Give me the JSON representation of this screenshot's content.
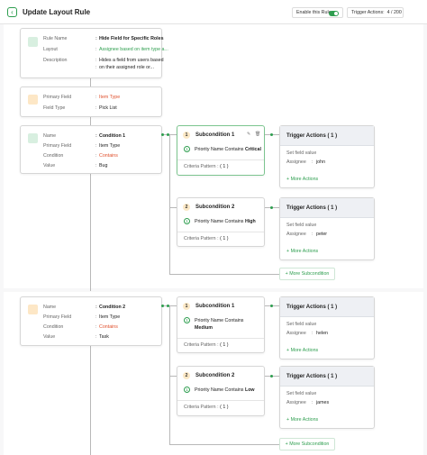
{
  "header": {
    "back_icon": "arrow-left-icon",
    "title": "Update Layout Rule",
    "enable_label": "Enable this Rule:",
    "trigger_label": "Trigger Actions:",
    "trigger_count": "4 / 200"
  },
  "rule": {
    "name_label": "Rule Name",
    "name": "Hide Field for Specific Roles",
    "layout_label": "Layout",
    "layout": "Assignee based on item type a...",
    "desc_label": "Description",
    "desc_line1": "Hides a field from users based",
    "desc_line2": "on their assigned role or..."
  },
  "primary": {
    "field_label": "Primary Field",
    "field": "Item Type",
    "type_label": "Field Type",
    "type": "Pick List"
  },
  "conditions": [
    {
      "name_label": "Name",
      "name": "Condition 1",
      "pf_label": "Primary Field",
      "pf": "Item Type",
      "cond_label": "Condition",
      "cond": "Contains",
      "value_label": "Value",
      "value": "Bug",
      "subconditions": [
        {
          "num": "1",
          "title": "Subcondition 1",
          "pnum": "1",
          "text": "Priority Name Contains",
          "value": "Critical",
          "pattern_label": "Criteria Pattern",
          "pattern": "( 1 )",
          "ta_title": "Trigger Actions  ( 1 )",
          "ta_action": "Set field value",
          "ta_field": "Assignee",
          "ta_value": "john",
          "ta_more": "+ More Actions"
        },
        {
          "num": "2",
          "title": "Subcondition 2",
          "pnum": "1",
          "text": "Priority Name Contains",
          "value": "High",
          "pattern_label": "Criteria Pattern",
          "pattern": "( 1 )",
          "ta_title": "Trigger Actions  ( 1 )",
          "ta_action": "Set field value",
          "ta_field": "Assignee",
          "ta_value": "peter",
          "ta_more": "+ More Actions"
        }
      ],
      "more_sub": "+ More Subcondition"
    },
    {
      "name_label": "Name",
      "name": "Condition 2",
      "pf_label": "Primary Field",
      "pf": "Item Type",
      "cond_label": "Condition",
      "cond": "Contains",
      "value_label": "Value",
      "value": "Task",
      "subconditions": [
        {
          "num": "1",
          "title": "Subcondition 1",
          "pnum": "1",
          "text": "Priority Name Contains",
          "value": "Medium",
          "pattern_label": "Criteria Pattern",
          "pattern": "( 1 )",
          "ta_title": "Trigger Actions  ( 1 )",
          "ta_action": "Set field value",
          "ta_field": "Assignee",
          "ta_value": "helen",
          "ta_more": "+ More Actions"
        },
        {
          "num": "2",
          "title": "Subcondition 2",
          "pnum": "1",
          "text": "Priority Name Contains",
          "value": "Low",
          "pattern_label": "Criteria Pattern",
          "pattern": "( 1 )",
          "ta_title": "Trigger Actions  ( 1 )",
          "ta_action": "Set field value",
          "ta_field": "Assignee",
          "ta_value": "james",
          "ta_more": "+ More Actions"
        }
      ],
      "more_sub": "+ More Subcondition"
    }
  ],
  "icons": {
    "edit": "edit-icon",
    "delete": "trash-icon"
  },
  "colors": {
    "accent": "#2e9e4f",
    "warning": "#e0502d"
  }
}
